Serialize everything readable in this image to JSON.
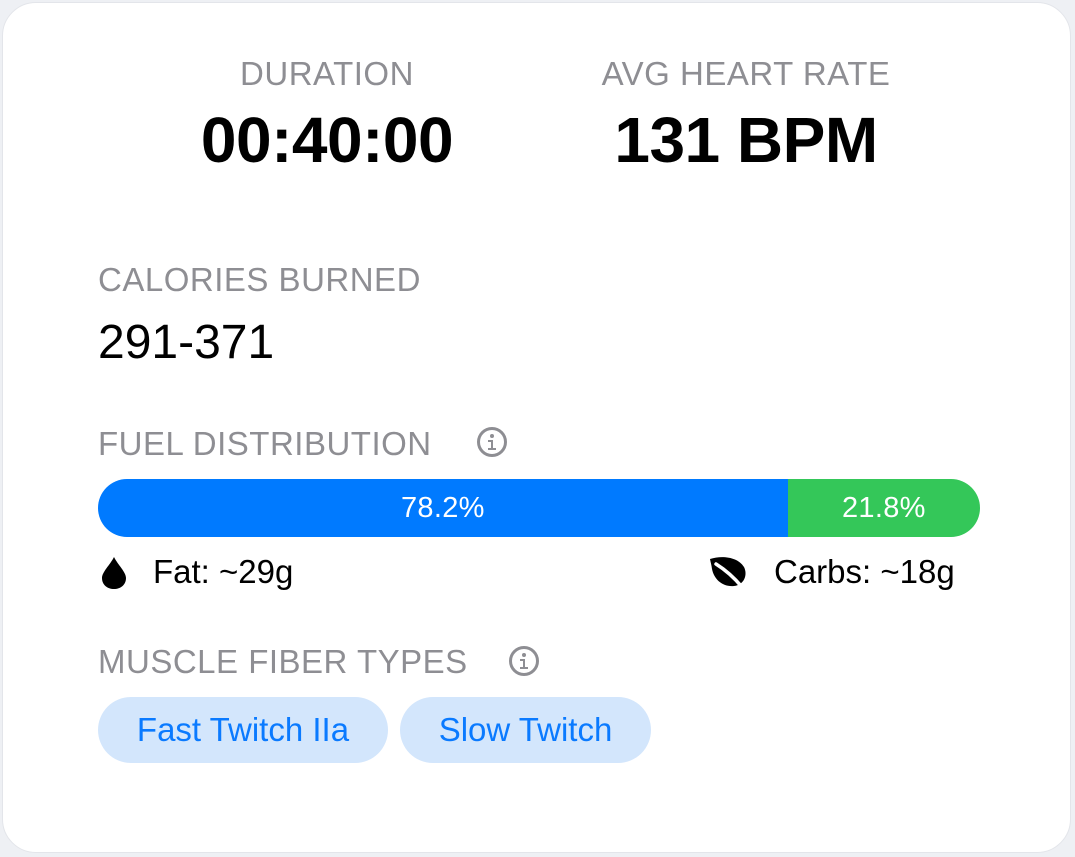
{
  "stats": {
    "duration": {
      "label": "DURATION",
      "value": "00:40:00"
    },
    "heart_rate": {
      "label": "AVG HEART RATE",
      "value": "131 BPM"
    }
  },
  "calories": {
    "label": "CALORIES BURNED",
    "value": "291-371"
  },
  "fuel": {
    "label": "FUEL DISTRIBUTION",
    "fat": {
      "percent": 78.2,
      "percent_label": "78.2%",
      "text": "Fat: ~29g",
      "color": "#007aff",
      "icon": "water-drop-icon"
    },
    "carbs": {
      "percent": 21.8,
      "percent_label": "21.8%",
      "text": "Carbs: ~18g",
      "color": "#34c759",
      "icon": "leaf-icon"
    }
  },
  "muscle": {
    "label": "MUSCLE FIBER TYPES",
    "chips": [
      "Fast Twitch IIa",
      "Slow Twitch"
    ]
  },
  "colors": {
    "label_gray": "#8e8e93",
    "chip_bg": "#d3e6fc",
    "chip_text": "#0a7aff"
  }
}
